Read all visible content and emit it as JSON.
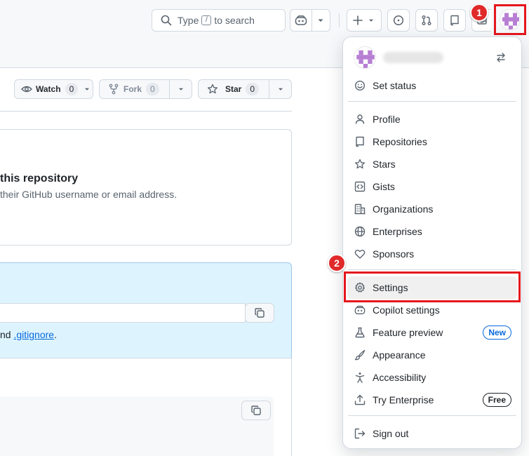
{
  "header": {
    "search": {
      "prefix": "Type",
      "key": "/",
      "suffix": "to search"
    }
  },
  "repo_actions": {
    "watch": {
      "label": "Watch",
      "count": "0"
    },
    "fork": {
      "label": "Fork",
      "count": "0"
    },
    "star": {
      "label": "Star",
      "count": "0"
    }
  },
  "main": {
    "invite_title": "this repository",
    "invite_desc": "their GitHub username or email address.",
    "quick_text_prefix": "nd",
    "quick_link": ".gitignore",
    "quick_text_suffix": "."
  },
  "annotations": {
    "step1": "1",
    "step2": "2"
  },
  "menu": {
    "set_status": "Set status",
    "items": [
      {
        "label": "Profile",
        "icon": "person-icon"
      },
      {
        "label": "Repositories",
        "icon": "repo-icon"
      },
      {
        "label": "Stars",
        "icon": "star-icon"
      },
      {
        "label": "Gists",
        "icon": "code-square-icon"
      },
      {
        "label": "Organizations",
        "icon": "organization-icon"
      },
      {
        "label": "Enterprises",
        "icon": "globe-icon"
      },
      {
        "label": "Sponsors",
        "icon": "heart-icon"
      }
    ],
    "items2": [
      {
        "label": "Settings",
        "icon": "gear-icon",
        "selected": true
      },
      {
        "label": "Copilot settings",
        "icon": "copilot-icon"
      },
      {
        "label": "Feature preview",
        "icon": "beaker-icon",
        "badge": "New"
      },
      {
        "label": "Appearance",
        "icon": "paintbrush-icon"
      },
      {
        "label": "Accessibility",
        "icon": "accessibility-icon"
      },
      {
        "label": "Try Enterprise",
        "icon": "upload-icon",
        "badge": "Free"
      }
    ],
    "sign_out": "Sign out"
  },
  "colors": {
    "accent": "#0969da",
    "annotation_red": "#e5161d",
    "avatar_purple": "#b77fd3"
  }
}
